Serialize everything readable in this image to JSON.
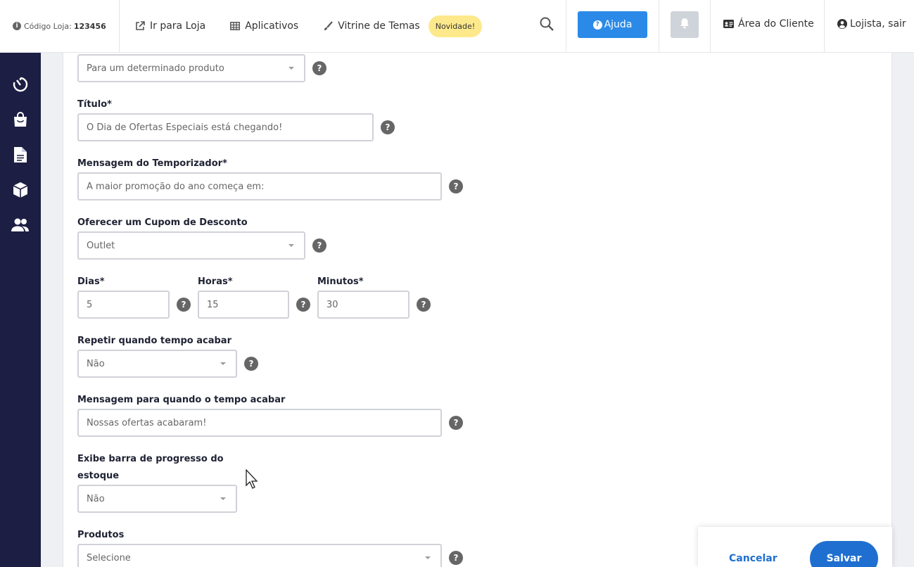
{
  "topbar": {
    "store_code_label": "Código Loja:",
    "store_code_value": "123456",
    "nav": {
      "store_link": "Ir para Loja",
      "apps": "Aplicativos",
      "themes": "Vitrine de Temas",
      "new_badge": "Novidade!"
    },
    "help": "Ajuda",
    "client_area": "Área do Cliente",
    "logout": "Lojista, sair"
  },
  "sidebar": {
    "items": [
      "dashboard-icon",
      "bag-icon",
      "document-icon",
      "box-icon",
      "users-icon"
    ]
  },
  "form": {
    "apply_to": {
      "value": "Para um determinado produto"
    },
    "title": {
      "label": "Título*",
      "value": "O Dia de Ofertas Especiais está chegando!"
    },
    "timer_message": {
      "label": "Mensagem do Temporizador*",
      "value": "A maior promoção do ano começa em:"
    },
    "coupon": {
      "label": "Oferecer um Cupom de Desconto",
      "value": "Outlet"
    },
    "days": {
      "label": "Dias*",
      "value": "5"
    },
    "hours": {
      "label": "Horas*",
      "value": "15"
    },
    "minutes": {
      "label": "Minutos*",
      "value": "30"
    },
    "repeat": {
      "label": "Repetir quando tempo acabar",
      "value": "Não"
    },
    "end_message": {
      "label": "Mensagem para quando o tempo acabar",
      "value": "Nossas ofertas acabaram!"
    },
    "stock_bar": {
      "label_line1": "Exibe barra de progresso do",
      "label_line2": "estoque",
      "value": "Não"
    },
    "products": {
      "label": "Produtos",
      "value": "Selecione"
    },
    "help_mark": "?"
  },
  "actions": {
    "cancel": "Cancelar",
    "save": "Salvar"
  },
  "colors": {
    "primary": "#2b8ae8",
    "save": "#1f6fd0",
    "sidebar": "#1c1e44",
    "badge": "#fde98b"
  }
}
